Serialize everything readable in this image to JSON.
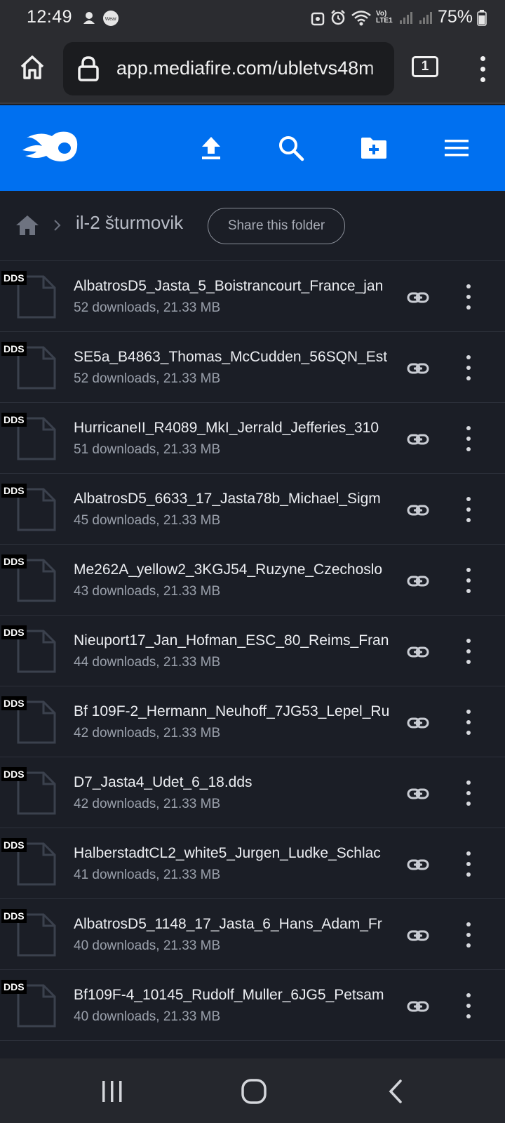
{
  "status_bar": {
    "time": "12:49",
    "battery_percent": "75%",
    "network_label": "Vo) LTE1"
  },
  "browser": {
    "url": "app.mediafire.com/ubletvs48m",
    "tab_count": "1"
  },
  "breadcrumb": {
    "folder_name": "il-2 šturmovik",
    "share_label": "Share this folder"
  },
  "file_badge": "DDS",
  "files": [
    {
      "name": "AlbatrosD5_Jasta_5_Boistrancourt_France_jan",
      "meta": "52 downloads, 21.33 MB"
    },
    {
      "name": "SE5a_B4863_Thomas_McCudden_56SQN_Est",
      "meta": "52 downloads, 21.33 MB"
    },
    {
      "name": "HurricaneII_R4089_MkI_Jerrald_Jefferies_310",
      "meta": "51 downloads, 21.33 MB"
    },
    {
      "name": "AlbatrosD5_6633_17_Jasta78b_Michael_Sigm",
      "meta": "45 downloads, 21.33 MB"
    },
    {
      "name": "Me262A_yellow2_3KGJ54_Ruzyne_Czechoslo",
      "meta": "43 downloads, 21.33 MB"
    },
    {
      "name": "Nieuport17_Jan_Hofman_ESC_80_Reims_Fran",
      "meta": "44 downloads, 21.33 MB"
    },
    {
      "name": "Bf 109F-2_Hermann_Neuhoff_7JG53_Lepel_Ru",
      "meta": "42 downloads, 21.33 MB"
    },
    {
      "name": "D7_Jasta4_Udet_6_18.dds",
      "meta": "42 downloads, 21.33 MB"
    },
    {
      "name": "HalberstadtCL2_white5_Jurgen_Ludke_Schlac",
      "meta": "41 downloads, 21.33 MB"
    },
    {
      "name": "AlbatrosD5_1148_17_Jasta_6_Hans_Adam_Fr",
      "meta": "40 downloads, 21.33 MB"
    },
    {
      "name": "Bf109F-4_10145_Rudolf_Muller_6JG5_Petsam",
      "meta": "40 downloads, 21.33 MB"
    }
  ],
  "colors": {
    "header_blue": "#0070f0",
    "background": "#1b1e26",
    "browser_chrome": "#2b2c30"
  },
  "icons": {
    "header": [
      "flame-logo-icon",
      "upload-icon",
      "search-icon",
      "new-folder-icon",
      "hamburger-menu-icon"
    ],
    "row": [
      "document-icon",
      "link-icon",
      "more-vertical-icon"
    ],
    "nav": [
      "recents-icon",
      "home-circle-icon",
      "back-icon"
    ]
  }
}
